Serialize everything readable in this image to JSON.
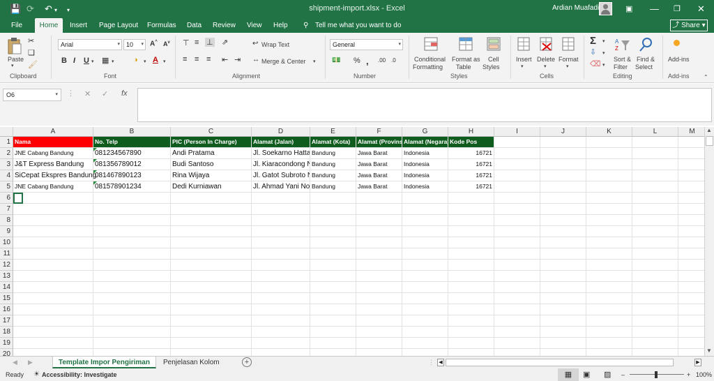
{
  "window": {
    "title": "shipment-import.xlsx  -  Excel",
    "user": "Ardian Muafadi"
  },
  "tabs": [
    "File",
    "Home",
    "Insert",
    "Page Layout",
    "Formulas",
    "Data",
    "Review",
    "View",
    "Help"
  ],
  "tell_me": "Tell me what you want to do",
  "share": "Share",
  "ribbon": {
    "clipboard": {
      "paste": "Paste",
      "group": "Clipboard"
    },
    "font": {
      "name": "Arial",
      "size": "10",
      "group": "Font"
    },
    "alignment": {
      "wrap": "Wrap Text",
      "merge": "Merge & Center",
      "group": "Alignment"
    },
    "number": {
      "format": "General",
      "group": "Number"
    },
    "styles": {
      "conditional_1": "Conditional",
      "conditional_2": "Formatting",
      "format_as_1": "Format as",
      "format_as_2": "Table",
      "cell_1": "Cell",
      "cell_2": "Styles",
      "group": "Styles"
    },
    "cells": {
      "insert": "Insert",
      "delete": "Delete",
      "format": "Format",
      "group": "Cells"
    },
    "editing": {
      "sort_1": "Sort &",
      "sort_2": "Filter",
      "find_1": "Find &",
      "find_2": "Select",
      "group": "Editing"
    },
    "addins": {
      "label": "Add-ins",
      "group": "Add-ins"
    }
  },
  "formula_bar": {
    "name_box": "O6",
    "fx": "fx",
    "value": ""
  },
  "columns": [
    "A",
    "B",
    "C",
    "D",
    "E",
    "F",
    "G",
    "H",
    "I",
    "J",
    "K",
    "L",
    "M"
  ],
  "rows": [
    "1",
    "2",
    "3",
    "4",
    "5",
    "6",
    "7",
    "8",
    "9",
    "10",
    "11",
    "12",
    "13",
    "14",
    "15",
    "16",
    "17",
    "18",
    "19",
    "20"
  ],
  "headers": [
    "Nama",
    "No. Telp",
    "PIC (Person In Charge)",
    "Alamat (Jalan)",
    "Alamat (Kota)",
    "Alamat (Provinsi)",
    "Alamat (Negara)",
    "Kode Pos"
  ],
  "table": [
    [
      "JNE Cabang Bandung",
      "081234567890",
      "Andi Pratama",
      "Jl. Soekarno Hatta",
      "Bandung",
      "Jawa Barat",
      "Indonesia",
      "16721"
    ],
    [
      "J&T Express Bandung",
      "081356789012",
      "Budi Santoso",
      "Jl. Kiaracondong N",
      "Bandung",
      "Jawa Barat",
      "Indonesia",
      "16721"
    ],
    [
      "SiCepat Ekspres Bandung",
      "081467890123",
      "Rina Wijaya",
      "Jl. Gatot Subroto N",
      "Bandung",
      "Jawa Barat",
      "Indonesia",
      "16721"
    ],
    [
      "JNE Cabang Bandung",
      "081578901234",
      "Dedi Kurniawan",
      "Jl. Ahmad Yani No",
      "Bandung",
      "Jawa Barat",
      "Indonesia",
      "16721"
    ]
  ],
  "sheets": [
    "Template Impor Pengiriman",
    "Penjelasan Kolom"
  ],
  "status": {
    "ready": "Ready",
    "accessibility": "Accessibility: Investigate",
    "zoom": "100%"
  },
  "colors": {
    "brand": "#217346",
    "header_fill": "#0f5c1f",
    "name_header_fill": "#ff0000"
  }
}
